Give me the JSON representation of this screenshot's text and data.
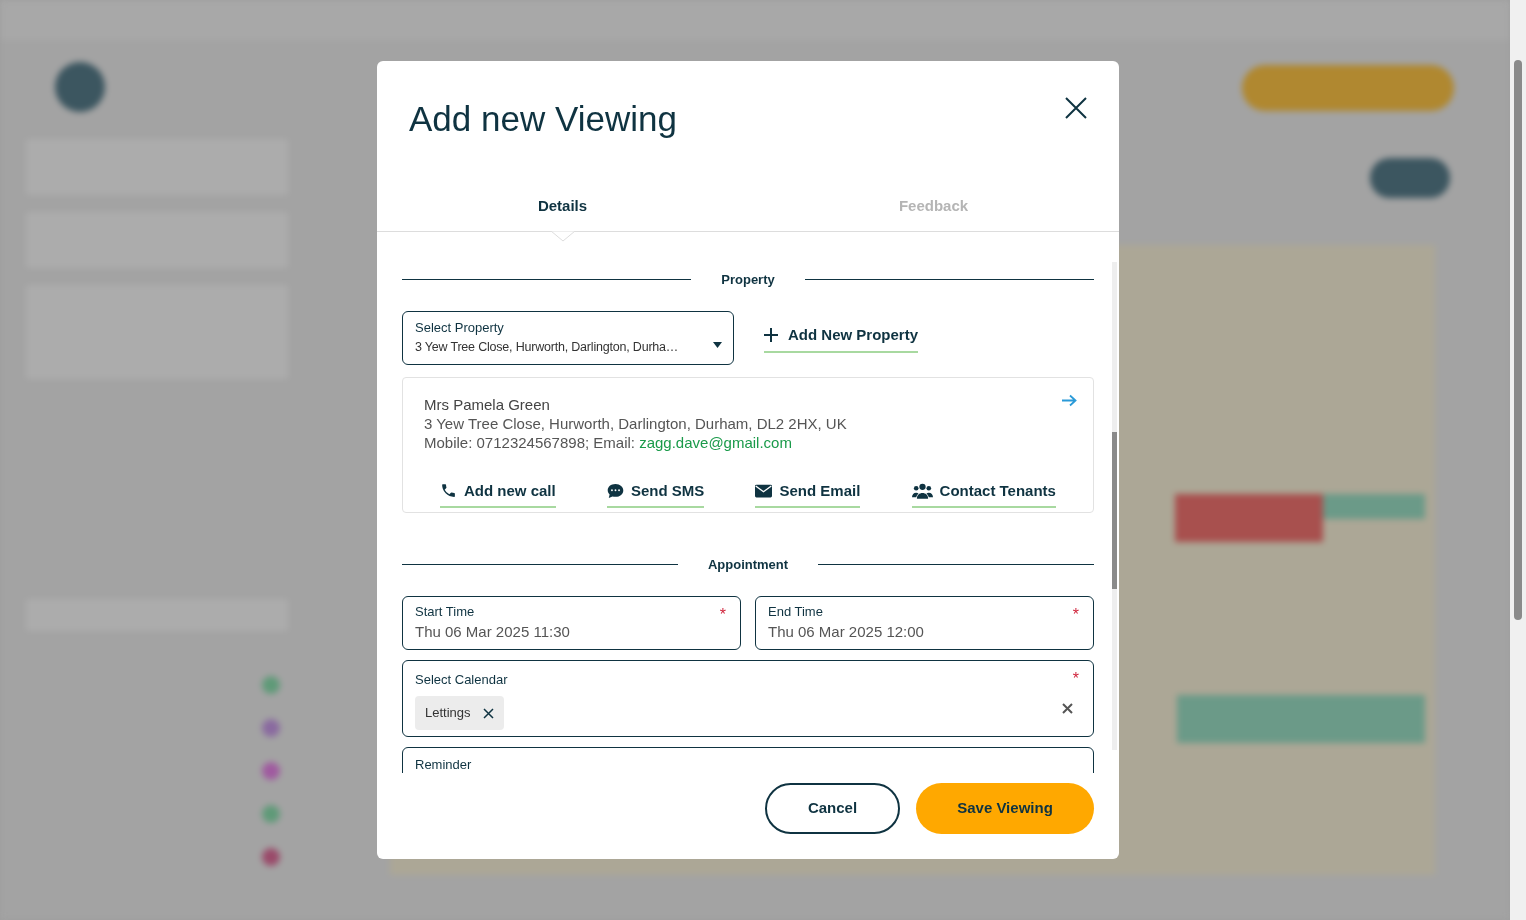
{
  "dialog": {
    "title": "Add new Viewing"
  },
  "tabs": [
    {
      "label": "Details",
      "selected": true
    },
    {
      "label": "Feedback",
      "selected": false
    }
  ],
  "property_section": {
    "heading": "Property",
    "select": {
      "label": "Select Property",
      "value": "3 Yew Tree Close, Hurworth, Darlington, Durha…"
    },
    "add_link": "Add New Property",
    "contact": {
      "name": "Mrs Pamela Green",
      "address": "3 Yew Tree Close, Hurworth, Darlington, Durham, DL2 2HX, UK",
      "details": "Mobile: 0712324567898; Email:",
      "email": "zagg.dave@gmail.com"
    },
    "actions": [
      {
        "kind": "call",
        "label": "Add new call"
      },
      {
        "kind": "sms",
        "label": "Send SMS"
      },
      {
        "kind": "email",
        "label": "Send Email"
      },
      {
        "kind": "tenants",
        "label": "Contact Tenants"
      }
    ]
  },
  "appointment_section": {
    "heading": "Appointment",
    "times": [
      {
        "label": "Start Time",
        "value": "Thu 06 Mar 2025 11:30",
        "required_mark": "*"
      },
      {
        "label": "End Time",
        "value": "Thu 06 Mar 2025 12:00",
        "required_mark": "*"
      }
    ],
    "calendar": {
      "label": "Select Calendar",
      "required_mark": "*",
      "tags": [
        "Lettings"
      ]
    },
    "reminder": {
      "label": "Reminder"
    }
  },
  "buttons": [
    {
      "kind": "secondary",
      "label": "Cancel"
    },
    {
      "kind": "primary",
      "label": "Save Viewing"
    }
  ]
}
